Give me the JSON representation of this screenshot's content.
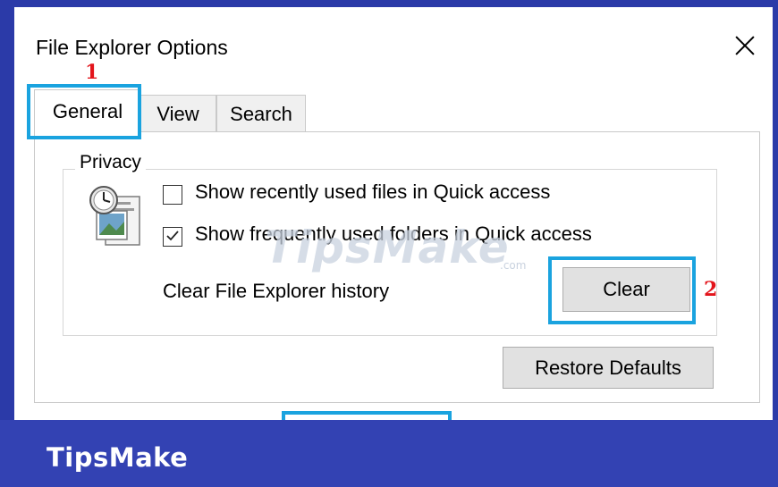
{
  "dialog": {
    "title": "File Explorer Options",
    "close_icon": "close-icon"
  },
  "annotations": {
    "step1": "1",
    "step2": "2",
    "highlight_color": "#1aa3df",
    "number_color": "#e3141b"
  },
  "tabs": [
    {
      "label": "General",
      "selected": true
    },
    {
      "label": "View",
      "selected": false
    },
    {
      "label": "Search",
      "selected": false
    }
  ],
  "privacy": {
    "group_label": "Privacy",
    "icon": "folder-options-icon",
    "options": [
      {
        "label": "Show recently used files in Quick access",
        "checked": false
      },
      {
        "label": "Show frequently used folders in Quick access",
        "checked": true
      }
    ],
    "history_label": "Clear File Explorer history",
    "clear_button": "Clear"
  },
  "restore_button": "Restore Defaults",
  "watermark": {
    "main": "TipsMake",
    "sub": ".com"
  },
  "brand": {
    "name": "TipsMake",
    "color": "#3342b3"
  }
}
